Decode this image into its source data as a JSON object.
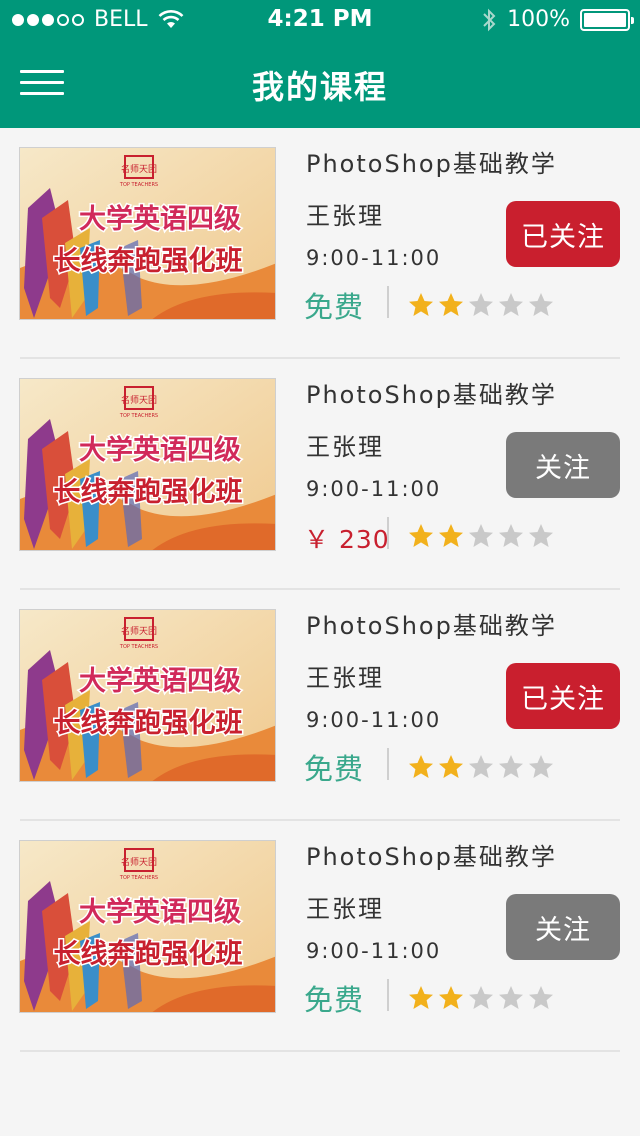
{
  "status_bar": {
    "carrier": "BELL",
    "time": "4:21 PM",
    "battery": "100%"
  },
  "header": {
    "title": "我的课程"
  },
  "colors": {
    "brand": "#00977a",
    "followed": "#c91f2e",
    "not_followed": "#7a7a7a",
    "free": "#3aa88c",
    "price": "#c8202f",
    "star_on": "#f2b11c",
    "star_off": "#c9c9c9"
  },
  "courses": [
    {
      "title": "PhotoShop基础教学",
      "teacher": "王张理",
      "time": "9:00-11:00",
      "price": "免费",
      "rating": 2,
      "max_rating": 5,
      "follow_label": "已关注",
      "followed": true,
      "thumb_text": {
        "logo_cn": "名师天团",
        "logo_en": "TOP TEACHERS",
        "line1": "大学英语四级",
        "line2": "长线奔跑强化班"
      }
    },
    {
      "title": "PhotoShop基础教学",
      "teacher": "王张理",
      "time": "9:00-11:00",
      "price": "￥ 230",
      "rating": 2,
      "max_rating": 5,
      "follow_label": "关注",
      "followed": false,
      "thumb_text": {
        "logo_cn": "名师天团",
        "logo_en": "TOP TEACHERS",
        "line1": "大学英语四级",
        "line2": "长线奔跑强化班"
      }
    },
    {
      "title": "PhotoShop基础教学",
      "teacher": "王张理",
      "time": "9:00-11:00",
      "price": "免费",
      "rating": 2,
      "max_rating": 5,
      "follow_label": "已关注",
      "followed": true,
      "thumb_text": {
        "logo_cn": "名师天团",
        "logo_en": "TOP TEACHERS",
        "line1": "大学英语四级",
        "line2": "长线奔跑强化班"
      }
    },
    {
      "title": "PhotoShop基础教学",
      "teacher": "王张理",
      "time": "9:00-11:00",
      "price": "免费",
      "rating": 2,
      "max_rating": 5,
      "follow_label": "关注",
      "followed": false,
      "thumb_text": {
        "logo_cn": "名师天团",
        "logo_en": "TOP TEACHERS",
        "line1": "大学英语四级",
        "line2": "长线奔跑强化班"
      }
    }
  ]
}
